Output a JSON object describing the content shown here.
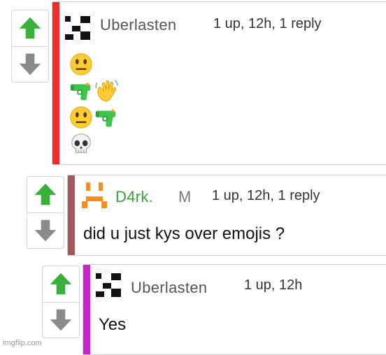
{
  "comments": [
    {
      "username": "Uberlasten",
      "meta": "1 up, 12h, 1 reply",
      "stripe_color": "#f22b2b",
      "username_color": "#555555",
      "emoji_lines": [
        [
          "neutral-face"
        ],
        [
          "water-pistol",
          "waving-hand"
        ],
        [
          "neutral-face",
          "water-pistol"
        ],
        [
          "skull"
        ]
      ]
    },
    {
      "username": "D4rk.",
      "flair": "M",
      "meta": "1 up, 12h, 1 reply",
      "stripe_color": "#a0585a",
      "username_color": "#3aa03a",
      "avatar_color": "#ff8c1a",
      "text": "did u just kys over emojis ?"
    },
    {
      "username": "Uberlasten",
      "meta": "1 up, 12h",
      "stripe_color": "#cc22cc",
      "username_color": "#555555",
      "text": "Yes"
    }
  ],
  "colors": {
    "upvote": "#3ab03a",
    "downvote": "#8a8a8a"
  },
  "watermark": "imgflip.com"
}
